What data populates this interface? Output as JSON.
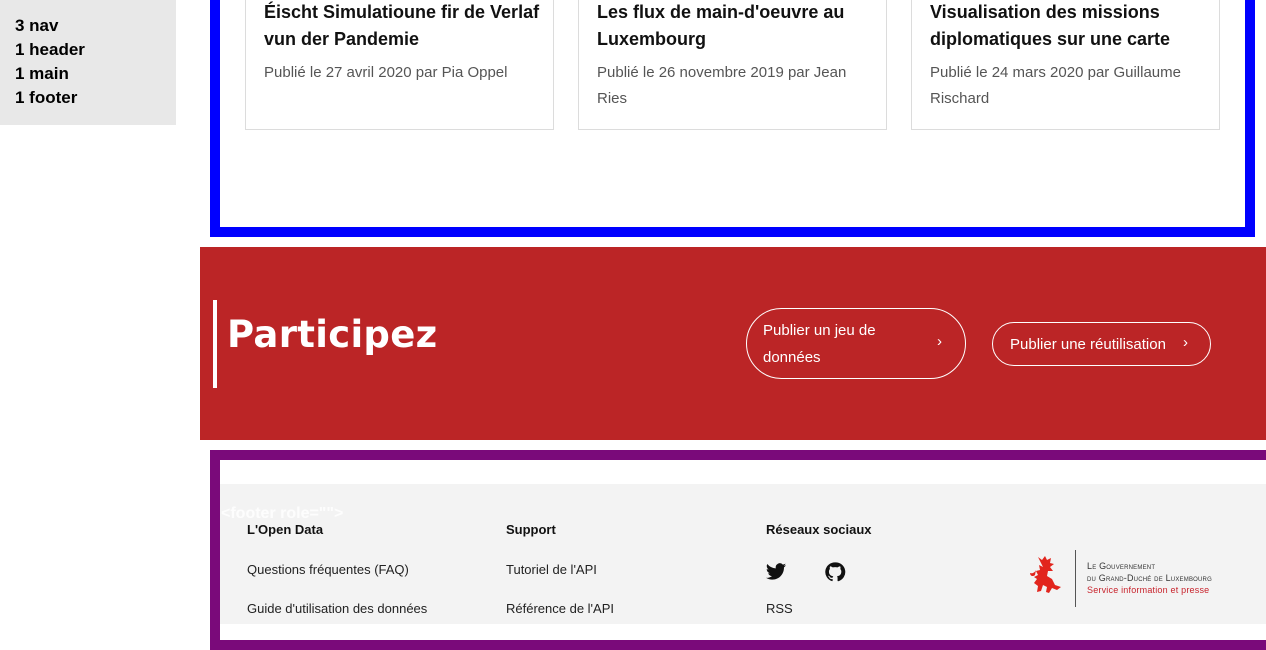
{
  "landmarks": {
    "nav": "3 nav",
    "header": "1 header",
    "main": "1 main",
    "footer": "1 footer"
  },
  "articles": [
    {
      "title": "Éischt Simulatioune fir de Verlaf vun der Pandemie",
      "meta": "Publié le 27 avril 2020 par Pia Oppel"
    },
    {
      "title": "Les flux de main-d'oeuvre au Luxembourg",
      "meta": "Publié le 26 novembre 2019 par Jean Ries"
    },
    {
      "title": "Visualisation des missions diplomatiques sur une carte",
      "meta": "Publié le 24 mars 2020 par Guillaume Rischard"
    }
  ],
  "participate": {
    "heading": "Participez",
    "publish_dataset": "Publier un jeu de données",
    "publish_reuse": "Publier une réutilisation",
    "chevron": "›"
  },
  "footer": {
    "tag": "<footer role=\"\">",
    "col1": {
      "title": "L'Open Data",
      "links": [
        "Questions fréquentes (FAQ)",
        "Guide d'utilisation des données"
      ]
    },
    "col2": {
      "title": "Support",
      "links": [
        "Tutoriel de l'API",
        "Référence de l'API"
      ]
    },
    "col3": {
      "title": "Réseaux sociaux",
      "icons": [
        "twitter-icon",
        "github-icon"
      ],
      "rss": "RSS"
    },
    "gov": {
      "line1": "Le Gouvernement",
      "line2": "du Grand-Duché de Luxembourg",
      "line3": "Service information et presse"
    }
  },
  "colors": {
    "main_outline": "#0000ff",
    "footer_outline": "#7a0a7a",
    "participate_bg": "#bb2526",
    "gov_red": "#e2251d"
  }
}
